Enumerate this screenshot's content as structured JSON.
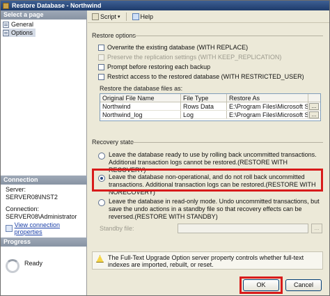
{
  "window": {
    "title": "Restore Database - Northwind"
  },
  "left_panel": {
    "select_page_header": "Select a page",
    "pages": [
      {
        "label": "General",
        "selected": false
      },
      {
        "label": "Options",
        "selected": true
      }
    ],
    "connection_header": "Connection",
    "server_label": "Server:",
    "server_value": "SERVER08\\INST2",
    "connection_label": "Connection:",
    "connection_value": "SERVER08\\Administrator",
    "view_connection_link": "View connection properties",
    "progress_header": "Progress",
    "progress_status": "Ready"
  },
  "toolbar": {
    "script_label": "Script",
    "help_label": "Help"
  },
  "restore_options": {
    "group_label": "Restore options",
    "items": [
      {
        "label": "Overwrite the existing database (WITH REPLACE)",
        "checked": false,
        "enabled": true
      },
      {
        "label": "Preserve the replication settings (WITH KEEP_REPLICATION)",
        "checked": false,
        "enabled": false
      },
      {
        "label": "Prompt before restoring each backup",
        "checked": false,
        "enabled": true
      },
      {
        "label": "Restrict access to the restored database (WITH RESTRICTED_USER)",
        "checked": false,
        "enabled": true
      }
    ]
  },
  "files": {
    "label": "Restore the database files as:",
    "columns": [
      "Original File Name",
      "File Type",
      "Restore As",
      ""
    ],
    "rows": [
      {
        "original": "Northwind",
        "type": "Rows Data",
        "restore_as": "E:\\Program Files\\Microsoft SQL ..."
      },
      {
        "original": "Northwind_log",
        "type": "Log",
        "restore_as": "E:\\Program Files\\Microsoft SQL ..."
      }
    ],
    "ellipsis": "..."
  },
  "recovery": {
    "group_label": "Recovery state",
    "options": [
      {
        "text": "Leave the database ready to use by rolling back uncommitted transactions. Additional transaction logs cannot be restored.(RESTORE WITH RECOVERY)",
        "selected": false
      },
      {
        "text": "Leave the database non-operational, and do not roll back uncommitted transactions. Additional transaction logs can be restored.(RESTORE WITH NORECOVERY)",
        "selected": true
      },
      {
        "text": "Leave the database in read-only mode. Undo uncommitted transactions, but save the undo actions in a standby file so that recovery effects can be reversed.(RESTORE WITH STANDBY)",
        "selected": false
      }
    ],
    "standby_label": "Standby file:",
    "standby_value": ""
  },
  "info_message": "The Full-Text Upgrade Option server property controls whether full-text indexes are imported, rebuilt, or reset.",
  "buttons": {
    "ok": "OK",
    "cancel": "Cancel"
  },
  "colors": {
    "highlight": "#d81b1b",
    "title_bar": "#1f3b6b",
    "link": "#1a3fa8"
  }
}
